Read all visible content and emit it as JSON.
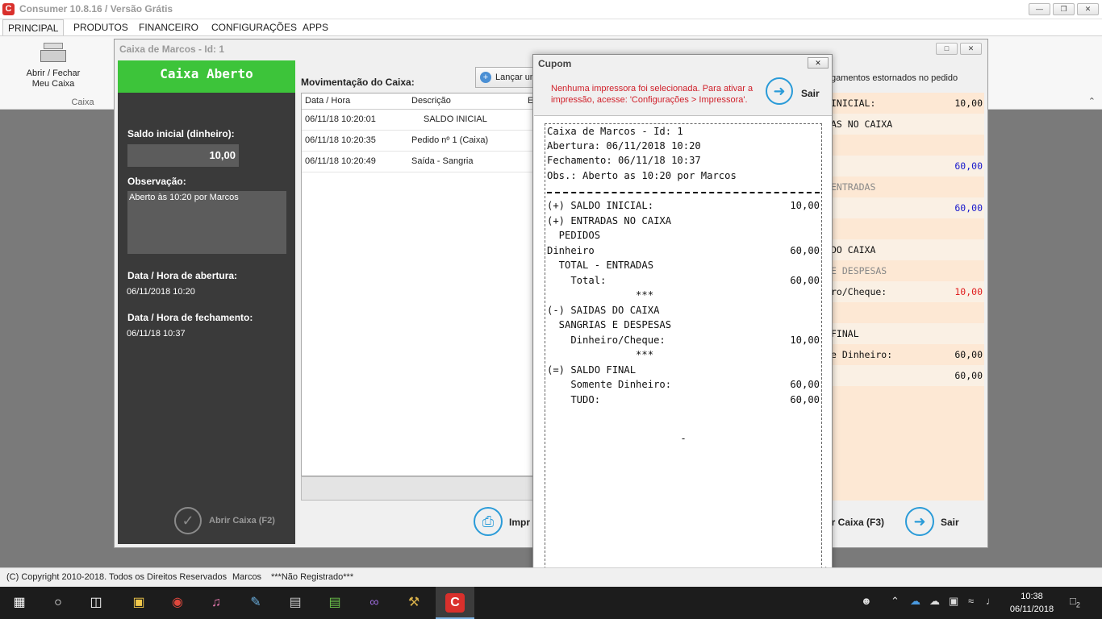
{
  "app": {
    "title": "Consumer 10.8.16 / Versão Grátis",
    "logo_letter": "C"
  },
  "menu": {
    "tabs": [
      "PRINCIPAL",
      "PRODUTOS",
      "FINANCEIRO",
      "CONFIGURAÇÕES",
      "APPS"
    ]
  },
  "ribbon": {
    "button_label_line1": "Abrir / Fechar",
    "button_label_line2": "Meu Caixa",
    "group_label": "Caixa"
  },
  "caixa_window": {
    "title": "Caixa de Marcos - Id: 1",
    "status_header": "Caixa Aberto",
    "saldo_inicial_label": "Saldo inicial (dinheiro):",
    "saldo_inicial_value": "10,00",
    "observacao_label": "Observação:",
    "observacao_value": "Aberto às 10:20 por Marcos",
    "abertura_label": "Data / Hora de abertura:",
    "abertura_value": "06/11/2018 10:20",
    "fechamento_label": "Data / Hora de fechamento:",
    "fechamento_value": "06/11/18 10:37",
    "abrir_button": "Abrir Caixa (F2)",
    "movimentacao_label": "Movimentação do Caixa:",
    "lancar_button": "Lançar um",
    "grid_headers": [
      "Data / Hora",
      "Descrição",
      "E"
    ],
    "grid_rows": [
      {
        "datetime": "06/11/18 10:20:01",
        "desc": "SALDO INICIAL"
      },
      {
        "datetime": "06/11/18 10:20:35",
        "desc": "Pedido nº 1 (Caixa)"
      },
      {
        "datetime": "06/11/18 10:20:49",
        "desc": "Saída - Sangria"
      }
    ],
    "imprimir_button": "Impr",
    "estornados_note": "gamentos estornados no pedido",
    "summary_rows": [
      {
        "label": "INICIAL:",
        "value": "10,00",
        "color": "#111111"
      },
      {
        "label": "AS NO CAIXA",
        "value": "",
        "color": "#111111"
      },
      {
        "label": "",
        "value": "",
        "color": "#111111"
      },
      {
        "label": "",
        "value": "60,00",
        "color": "#1a1acc"
      },
      {
        "label": "ENTRADAS",
        "value": "",
        "color": "#888888"
      },
      {
        "label": "",
        "value": "60,00",
        "color": "#1a1acc"
      },
      {
        "label": "",
        "value": "",
        "color": "#111111"
      },
      {
        "label": "DO CAIXA",
        "value": "",
        "color": "#111111"
      },
      {
        "label": "E DESPESAS",
        "value": "",
        "color": "#888888"
      },
      {
        "label": "ro/Cheque:",
        "value": "10,00",
        "color": "#e02020"
      },
      {
        "label": "",
        "value": "",
        "color": "#111111"
      },
      {
        "label": "FINAL",
        "value": "",
        "color": "#111111"
      },
      {
        "label": "e Dinheiro:",
        "value": "60,00",
        "color": "#111111"
      },
      {
        "label": "",
        "value": "60,00",
        "color": "#111111"
      }
    ],
    "fechar_button": "ar Caixa (F3)",
    "sair_button": "Sair"
  },
  "cupom": {
    "title": "Cupom",
    "warning": "Nenhuma impressora foi selecionada. Para ativar a impressão, acesse: 'Configurações > Impressora'.",
    "sair_label": "Sair",
    "header_lines": [
      "Caixa de Marcos - Id: 1",
      "Abertura: 06/11/2018 10:20",
      "Fechamento: 06/11/18 10:37",
      "Obs.: Aberto as 10:20 por Marcos"
    ],
    "body_lines": [
      {
        "text": "(+) SALDO INICIAL:",
        "value": "10,00"
      },
      {
        "text": "(+) ENTRADAS NO CAIXA",
        "value": ""
      },
      {
        "text": "  PEDIDOS",
        "value": ""
      },
      {
        "text": "Dinheiro",
        "value": "60,00"
      },
      {
        "text": "  TOTAL - ENTRADAS",
        "value": ""
      },
      {
        "text": "    Total:",
        "value": "60,00"
      },
      {
        "text": "               ***",
        "value": ""
      },
      {
        "text": "(-) SAIDAS DO CAIXA",
        "value": ""
      },
      {
        "text": "  SANGRIAS E DESPESAS",
        "value": ""
      },
      {
        "text": "    Dinheiro/Cheque:",
        "value": "10,00"
      },
      {
        "text": "               ***",
        "value": ""
      },
      {
        "text": "(=) SALDO FINAL",
        "value": ""
      },
      {
        "text": "    Somente Dinheiro:",
        "value": "60,00"
      },
      {
        "text": "    TUDO:",
        "value": "60,00"
      }
    ],
    "footer_mark": "-"
  },
  "statusbar": {
    "copyright": "(C) Copyright 2010-2018. Todos os Direitos Reservados",
    "user": "Marcos",
    "registration": "***Não Registrado***"
  },
  "taskbar": {
    "time": "10:38",
    "date": "06/11/2018",
    "notification_count": "2"
  }
}
